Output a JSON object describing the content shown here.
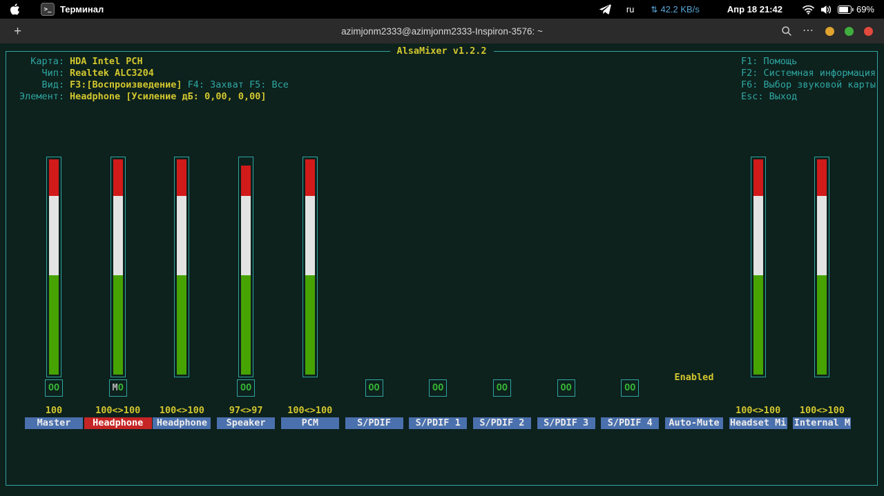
{
  "topbar": {
    "app_title": "Терминал",
    "lang": "ru",
    "net_speed": "42.2 KB/s",
    "clock": "Апр 18 21:42",
    "battery": "69%"
  },
  "window": {
    "new_tab": "+",
    "title": "azimjonm2333@azimjonm2333-Inspiron-3576: ~",
    "menu": "⋯"
  },
  "alsamixer": {
    "title": "AlsaMixer v1.2.2",
    "info_rows": [
      {
        "key": "Карта:",
        "value": "HDA Intel PCH"
      },
      {
        "key": "Чип:",
        "value": "Realtek ALC3204"
      },
      {
        "key": "Вид:",
        "value": "F3:[Воспроизведение]",
        "extra": "F4: Захват  F5: Все"
      },
      {
        "key": "Элемент:",
        "value": "Headphone [Усиление дБ: 0,00, 0,00]"
      }
    ],
    "help": [
      "F1: Помощь",
      "F2: Системная информация",
      "F6: Выбор звуковой карты",
      "Esc: Выход"
    ],
    "gauge_zones": {
      "green": 46,
      "white": 37,
      "red": 17
    },
    "colors": {
      "teal": "#2fa7a2",
      "yellow": "#d2c72e",
      "label_bg": "#4a70ad",
      "selected_bg": "#c52525",
      "bar_green": "#46a302",
      "bar_white": "#e3e3e3",
      "bar_red": "#d11a1a",
      "switch_on": "#35b335"
    },
    "channels": [
      {
        "name": "Master",
        "has_bar": true,
        "level": 100,
        "value": "100",
        "switch": "OO",
        "selected": false
      },
      {
        "name": "Headphone",
        "has_bar": true,
        "level": 100,
        "value": "100<>100",
        "switch": "MO",
        "selected": true
      },
      {
        "name": "Headphone",
        "has_bar": true,
        "level": 100,
        "value": "100<>100",
        "switch": null,
        "selected": false
      },
      {
        "name": "Speaker",
        "has_bar": true,
        "level": 97,
        "value": "97<>97",
        "switch": "OO",
        "selected": false
      },
      {
        "name": "PCM",
        "has_bar": true,
        "level": 100,
        "value": "100<>100",
        "switch": null,
        "selected": false
      },
      {
        "name": "S/PDIF",
        "has_bar": false,
        "switch": "OO",
        "selected": false
      },
      {
        "name": "S/PDIF 1",
        "has_bar": false,
        "switch": "OO",
        "selected": false
      },
      {
        "name": "S/PDIF 2",
        "has_bar": false,
        "switch": "OO",
        "selected": false
      },
      {
        "name": "S/PDIF 3",
        "has_bar": false,
        "switch": "OO",
        "selected": false
      },
      {
        "name": "S/PDIF 4",
        "has_bar": false,
        "switch": "OO",
        "selected": false
      },
      {
        "name": "Auto-Mute",
        "has_bar": false,
        "status": "Enabled",
        "selected": false
      },
      {
        "name": "Headset Mi",
        "has_bar": true,
        "level": 100,
        "value": "100<>100",
        "switch": null,
        "selected": false
      },
      {
        "name": "Internal M",
        "has_bar": true,
        "level": 100,
        "value": "100<>100",
        "switch": null,
        "selected": false
      }
    ]
  }
}
